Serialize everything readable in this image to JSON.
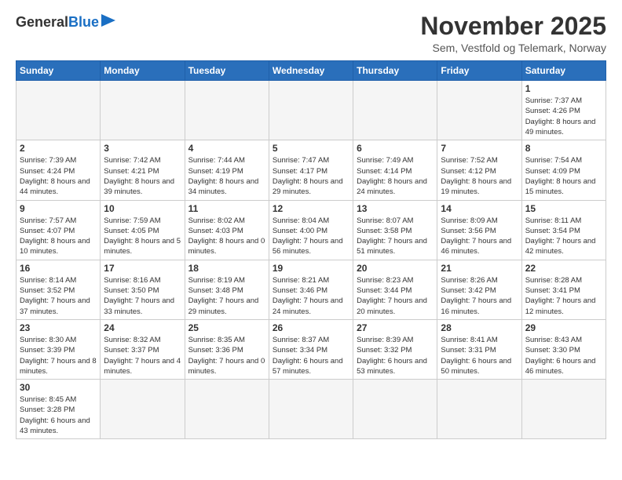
{
  "header": {
    "logo_general": "General",
    "logo_blue": "Blue",
    "title": "November 2025",
    "subtitle": "Sem, Vestfold og Telemark, Norway"
  },
  "weekdays": [
    "Sunday",
    "Monday",
    "Tuesday",
    "Wednesday",
    "Thursday",
    "Friday",
    "Saturday"
  ],
  "weeks": [
    [
      {
        "day": "",
        "info": ""
      },
      {
        "day": "",
        "info": ""
      },
      {
        "day": "",
        "info": ""
      },
      {
        "day": "",
        "info": ""
      },
      {
        "day": "",
        "info": ""
      },
      {
        "day": "",
        "info": ""
      },
      {
        "day": "1",
        "info": "Sunrise: 7:37 AM\nSunset: 4:26 PM\nDaylight: 8 hours\nand 49 minutes."
      }
    ],
    [
      {
        "day": "2",
        "info": "Sunrise: 7:39 AM\nSunset: 4:24 PM\nDaylight: 8 hours\nand 44 minutes."
      },
      {
        "day": "3",
        "info": "Sunrise: 7:42 AM\nSunset: 4:21 PM\nDaylight: 8 hours\nand 39 minutes."
      },
      {
        "day": "4",
        "info": "Sunrise: 7:44 AM\nSunset: 4:19 PM\nDaylight: 8 hours\nand 34 minutes."
      },
      {
        "day": "5",
        "info": "Sunrise: 7:47 AM\nSunset: 4:17 PM\nDaylight: 8 hours\nand 29 minutes."
      },
      {
        "day": "6",
        "info": "Sunrise: 7:49 AM\nSunset: 4:14 PM\nDaylight: 8 hours\nand 24 minutes."
      },
      {
        "day": "7",
        "info": "Sunrise: 7:52 AM\nSunset: 4:12 PM\nDaylight: 8 hours\nand 19 minutes."
      },
      {
        "day": "8",
        "info": "Sunrise: 7:54 AM\nSunset: 4:09 PM\nDaylight: 8 hours\nand 15 minutes."
      }
    ],
    [
      {
        "day": "9",
        "info": "Sunrise: 7:57 AM\nSunset: 4:07 PM\nDaylight: 8 hours\nand 10 minutes."
      },
      {
        "day": "10",
        "info": "Sunrise: 7:59 AM\nSunset: 4:05 PM\nDaylight: 8 hours\nand 5 minutes."
      },
      {
        "day": "11",
        "info": "Sunrise: 8:02 AM\nSunset: 4:03 PM\nDaylight: 8 hours\nand 0 minutes."
      },
      {
        "day": "12",
        "info": "Sunrise: 8:04 AM\nSunset: 4:00 PM\nDaylight: 7 hours\nand 56 minutes."
      },
      {
        "day": "13",
        "info": "Sunrise: 8:07 AM\nSunset: 3:58 PM\nDaylight: 7 hours\nand 51 minutes."
      },
      {
        "day": "14",
        "info": "Sunrise: 8:09 AM\nSunset: 3:56 PM\nDaylight: 7 hours\nand 46 minutes."
      },
      {
        "day": "15",
        "info": "Sunrise: 8:11 AM\nSunset: 3:54 PM\nDaylight: 7 hours\nand 42 minutes."
      }
    ],
    [
      {
        "day": "16",
        "info": "Sunrise: 8:14 AM\nSunset: 3:52 PM\nDaylight: 7 hours\nand 37 minutes."
      },
      {
        "day": "17",
        "info": "Sunrise: 8:16 AM\nSunset: 3:50 PM\nDaylight: 7 hours\nand 33 minutes."
      },
      {
        "day": "18",
        "info": "Sunrise: 8:19 AM\nSunset: 3:48 PM\nDaylight: 7 hours\nand 29 minutes."
      },
      {
        "day": "19",
        "info": "Sunrise: 8:21 AM\nSunset: 3:46 PM\nDaylight: 7 hours\nand 24 minutes."
      },
      {
        "day": "20",
        "info": "Sunrise: 8:23 AM\nSunset: 3:44 PM\nDaylight: 7 hours\nand 20 minutes."
      },
      {
        "day": "21",
        "info": "Sunrise: 8:26 AM\nSunset: 3:42 PM\nDaylight: 7 hours\nand 16 minutes."
      },
      {
        "day": "22",
        "info": "Sunrise: 8:28 AM\nSunset: 3:41 PM\nDaylight: 7 hours\nand 12 minutes."
      }
    ],
    [
      {
        "day": "23",
        "info": "Sunrise: 8:30 AM\nSunset: 3:39 PM\nDaylight: 7 hours\nand 8 minutes."
      },
      {
        "day": "24",
        "info": "Sunrise: 8:32 AM\nSunset: 3:37 PM\nDaylight: 7 hours\nand 4 minutes."
      },
      {
        "day": "25",
        "info": "Sunrise: 8:35 AM\nSunset: 3:36 PM\nDaylight: 7 hours\nand 0 minutes."
      },
      {
        "day": "26",
        "info": "Sunrise: 8:37 AM\nSunset: 3:34 PM\nDaylight: 6 hours\nand 57 minutes."
      },
      {
        "day": "27",
        "info": "Sunrise: 8:39 AM\nSunset: 3:32 PM\nDaylight: 6 hours\nand 53 minutes."
      },
      {
        "day": "28",
        "info": "Sunrise: 8:41 AM\nSunset: 3:31 PM\nDaylight: 6 hours\nand 50 minutes."
      },
      {
        "day": "29",
        "info": "Sunrise: 8:43 AM\nSunset: 3:30 PM\nDaylight: 6 hours\nand 46 minutes."
      }
    ],
    [
      {
        "day": "30",
        "info": "Sunrise: 8:45 AM\nSunset: 3:28 PM\nDaylight: 6 hours\nand 43 minutes."
      },
      {
        "day": "",
        "info": ""
      },
      {
        "day": "",
        "info": ""
      },
      {
        "day": "",
        "info": ""
      },
      {
        "day": "",
        "info": ""
      },
      {
        "day": "",
        "info": ""
      },
      {
        "day": "",
        "info": ""
      }
    ]
  ]
}
